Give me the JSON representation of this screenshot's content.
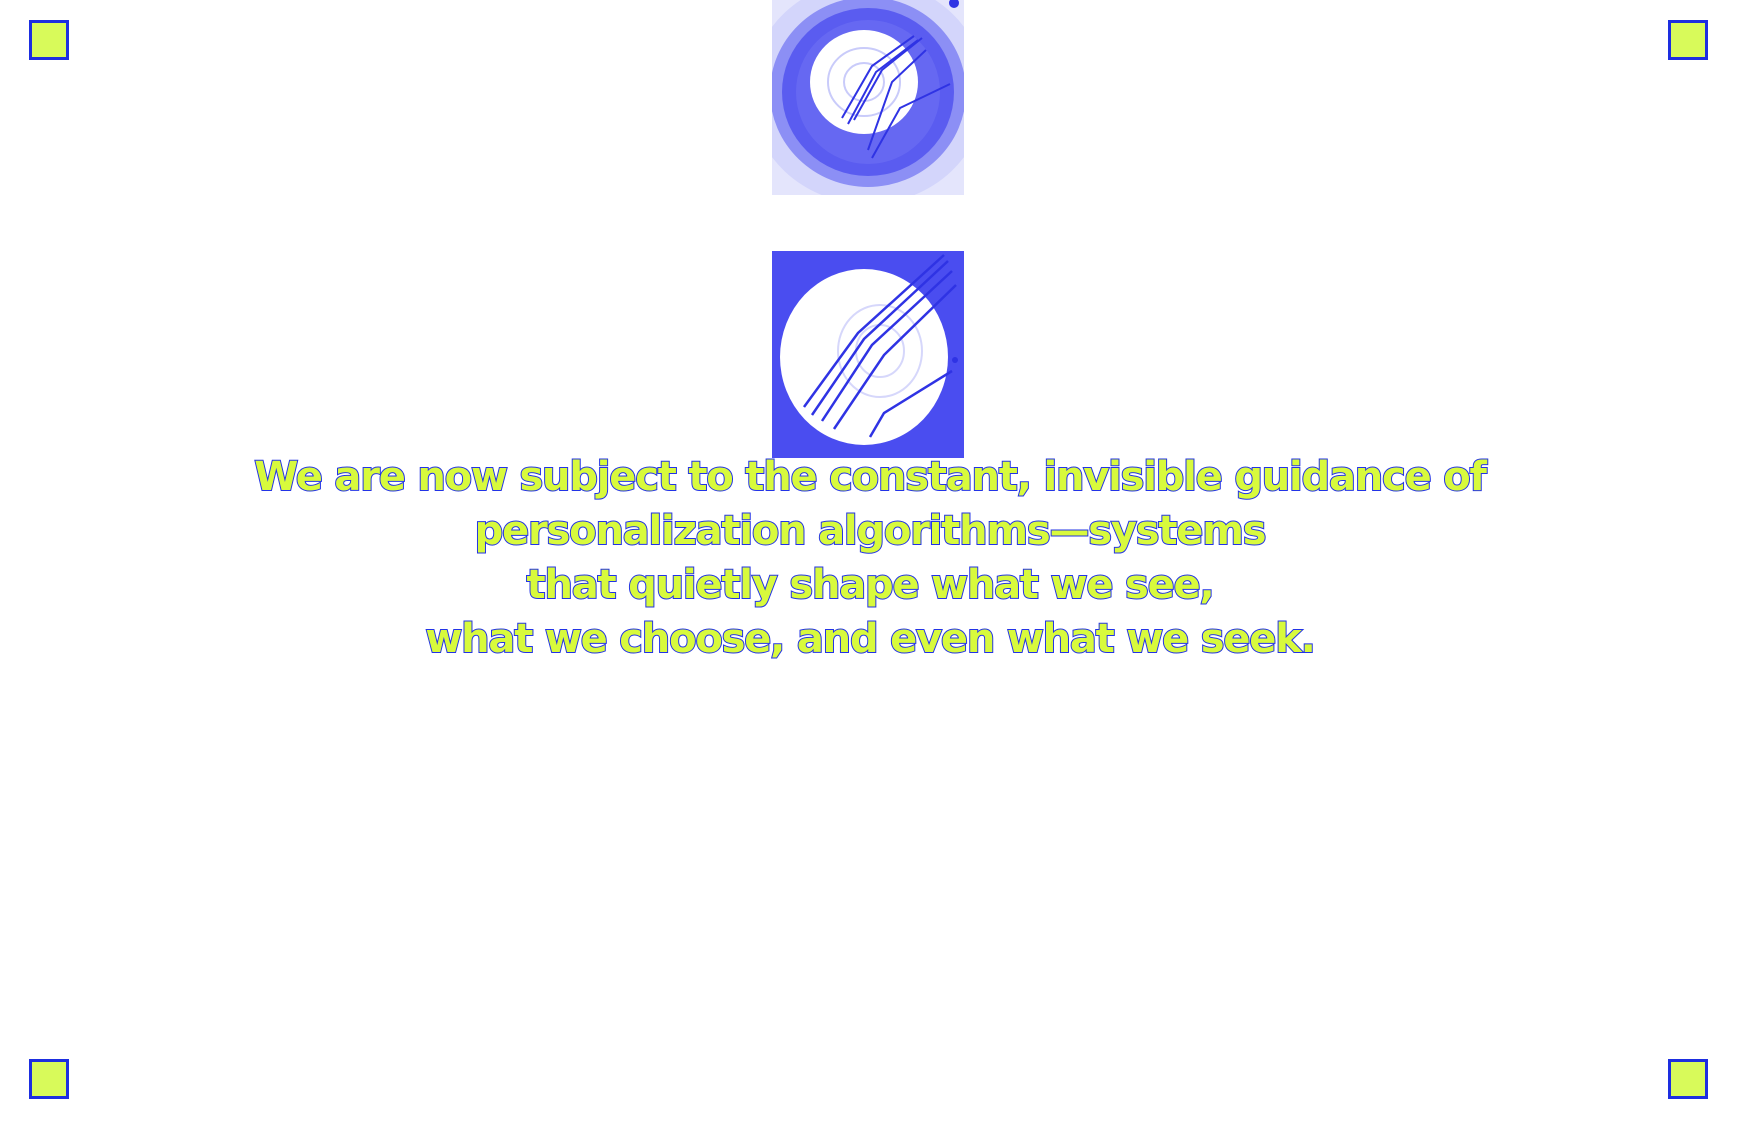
{
  "colors": {
    "accent_fill": "#d8fa5a",
    "accent_stroke": "#1d2ee0",
    "image_blue": "#4a4df0",
    "background": "#ffffff"
  },
  "images": {
    "top_image": "archery-target-with-arrows",
    "middle_image": "archery-target-with-arrows-closeup"
  },
  "corner_markers": [
    "top-left",
    "top-right",
    "bottom-left",
    "bottom-right"
  ],
  "quote": {
    "lines": [
      "We are now subject to the constant, invisible guidance of",
      "personalization algorithms—systems",
      "that quietly shape what we see,",
      "what we choose, and even what we seek."
    ]
  }
}
